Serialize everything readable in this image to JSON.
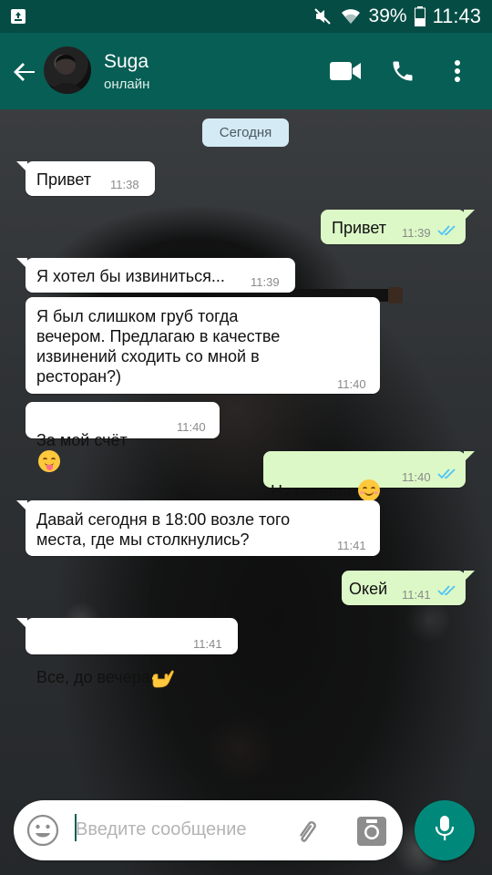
{
  "status_bar": {
    "battery": "39%",
    "time": "11:43"
  },
  "header": {
    "contact_name": "Suga",
    "contact_status": "онлайн"
  },
  "chat": {
    "date_label": "Сегодня",
    "messages": [
      {
        "dir": "in",
        "text": "Привет",
        "time": "11:38"
      },
      {
        "dir": "out",
        "text": "Привет",
        "time": "11:39",
        "read": true
      },
      {
        "dir": "in",
        "text": "Я хотел бы извиниться...",
        "time": "11:39"
      },
      {
        "dir": "in",
        "text": "Я был слишком груб тогда\nвечером. Предлагаю в качестве\nизвинений сходить со мной в\nресторан?)",
        "time": "11:40"
      },
      {
        "dir": "in",
        "text": "За мой счёт",
        "emoji": "face-savoring-food",
        "time": "11:40"
      },
      {
        "dir": "out",
        "text": "Ну погнали",
        "emoji": "smiling-face-blush",
        "time": "11:40",
        "read": true
      },
      {
        "dir": "in",
        "text": "Давай сегодня в 18:00 возле того\nместа, где мы столкнулись?",
        "time": "11:41"
      },
      {
        "dir": "out",
        "text": "Окей",
        "time": "11:41",
        "read": true
      },
      {
        "dir": "in",
        "text": "Все, до вечера",
        "emoji": "call-me-hand",
        "time": "11:41"
      }
    ]
  },
  "composer": {
    "placeholder": "Введите сообщение"
  },
  "colors": {
    "status_bar": "#054d44",
    "app_bar": "#075e54",
    "incoming_bubble": "#ffffff",
    "outgoing_bubble": "#dcf8c6",
    "read_ticks": "#4fc3f7",
    "date_chip": "#d4eaf4",
    "mic_button": "#00897b"
  },
  "icons": [
    "recycle-icon",
    "mute-icon",
    "wifi-icon",
    "battery-icon",
    "back-arrow-icon",
    "video-call-icon",
    "phone-icon",
    "more-vert-icon",
    "emoji-icon",
    "attach-icon",
    "camera-icon",
    "mic-icon"
  ]
}
